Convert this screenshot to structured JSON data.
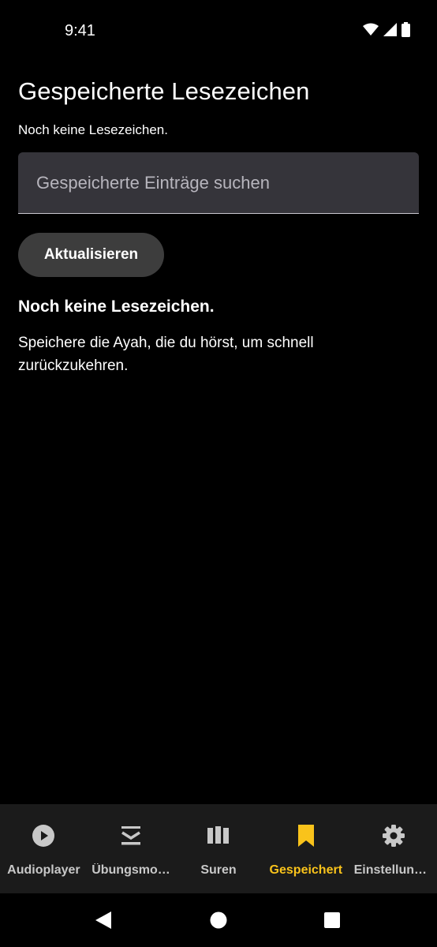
{
  "status_bar": {
    "time": "9:41",
    "icons": [
      "wifi-icon",
      "signal-icon",
      "battery-icon"
    ]
  },
  "header": {
    "title": "Gespeicherte Lesezeichen",
    "subtitle": "Noch keine Lesezeichen."
  },
  "search": {
    "placeholder": "Gespeicherte Einträge suchen",
    "value": ""
  },
  "refresh_button": {
    "label": "Aktualisieren"
  },
  "empty_state": {
    "heading": "Noch keine Lesezeichen.",
    "text": "Speichere die Ayah, die du hörst, um schnell zurückzukehren."
  },
  "bottom_nav": {
    "active_index": 3,
    "active_color": "#f9c31b",
    "items": [
      {
        "label": "Audioplayer",
        "icon": "play-circle-icon"
      },
      {
        "label": "Übungsmodus",
        "icon": "practice-icon"
      },
      {
        "label": "Suren",
        "icon": "library-icon"
      },
      {
        "label": "Gespeichert",
        "icon": "bookmark-icon"
      },
      {
        "label": "Einstellungen",
        "icon": "gear-icon"
      }
    ]
  },
  "system_nav": [
    "back-icon",
    "home-icon",
    "recents-icon"
  ]
}
